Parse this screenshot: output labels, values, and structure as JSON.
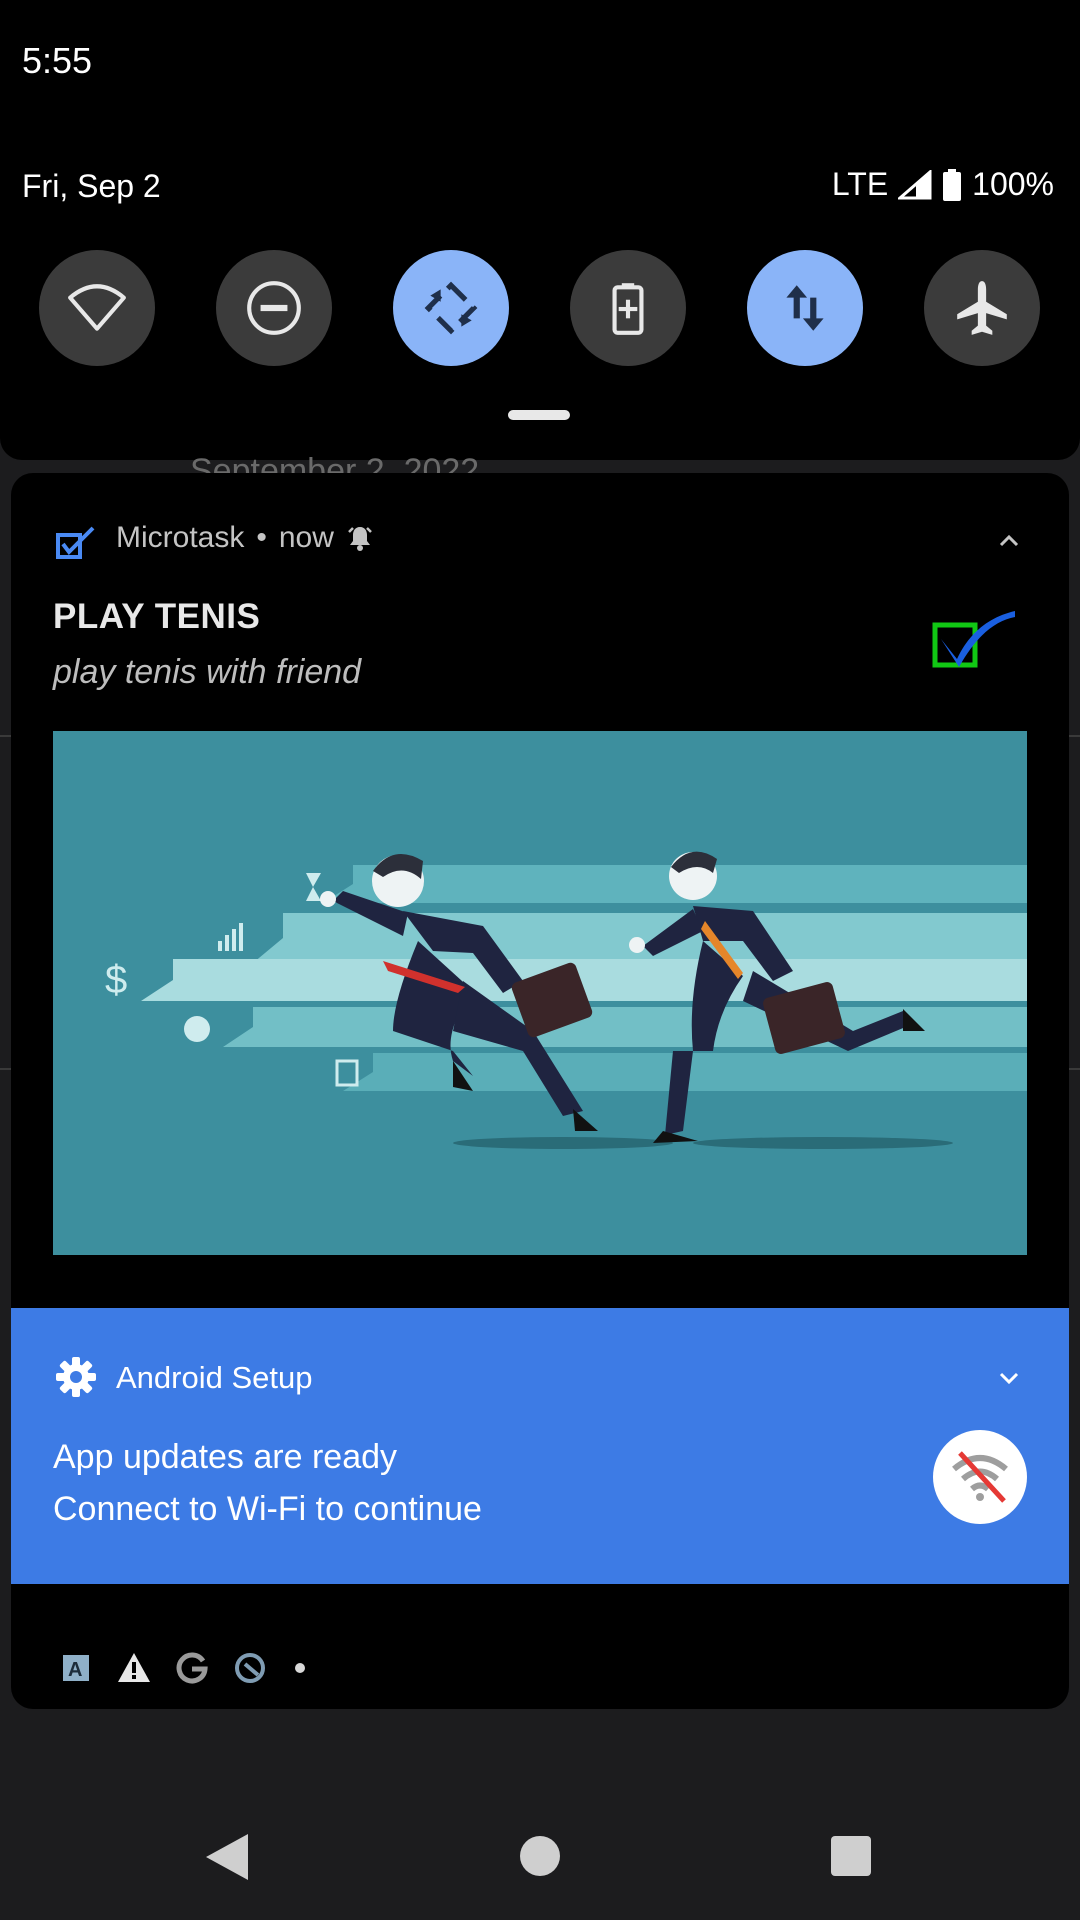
{
  "status_bar": {
    "time": "5:55",
    "date": "Fri, Sep 2",
    "network": "LTE",
    "battery": "100%"
  },
  "quick_settings": {
    "tiles": [
      {
        "name": "wifi",
        "icon": "wifi-icon",
        "active": false
      },
      {
        "name": "do-not-disturb",
        "icon": "dnd-icon",
        "active": false
      },
      {
        "name": "auto-rotate",
        "icon": "rotate-icon",
        "active": true
      },
      {
        "name": "battery-saver",
        "icon": "battery-saver-icon",
        "active": false
      },
      {
        "name": "mobile-data",
        "icon": "data-arrows-icon",
        "active": true
      },
      {
        "name": "airplane-mode",
        "icon": "airplane-icon",
        "active": false
      }
    ],
    "active_color": "#8ab4f8",
    "inactive_color": "#3b3b3b"
  },
  "behind": {
    "text": "September 2, 2022"
  },
  "notifications": {
    "microtask": {
      "app_name": "Microtask",
      "time": "now",
      "title": "PLAY TENIS",
      "text": "play tenis with friend",
      "app_icon": "checkbox-icon",
      "alert_icon": "alarm-bell-icon",
      "picture": "businessmen-running-illustration"
    },
    "setup": {
      "app_name": "Android Setup",
      "line1": "App updates are ready",
      "line2": "Connect to Wi-Fi to continue",
      "icon": "gear-icon",
      "badge_icon": "wifi-off-icon",
      "color": "#3d7be5"
    }
  },
  "overflow_icons": [
    "accessibility-a-icon",
    "warning-icon",
    "google-g-icon",
    "data-saver-icon",
    "more-dot-icon"
  ],
  "nav": [
    "back-button",
    "home-button",
    "recents-button"
  ]
}
